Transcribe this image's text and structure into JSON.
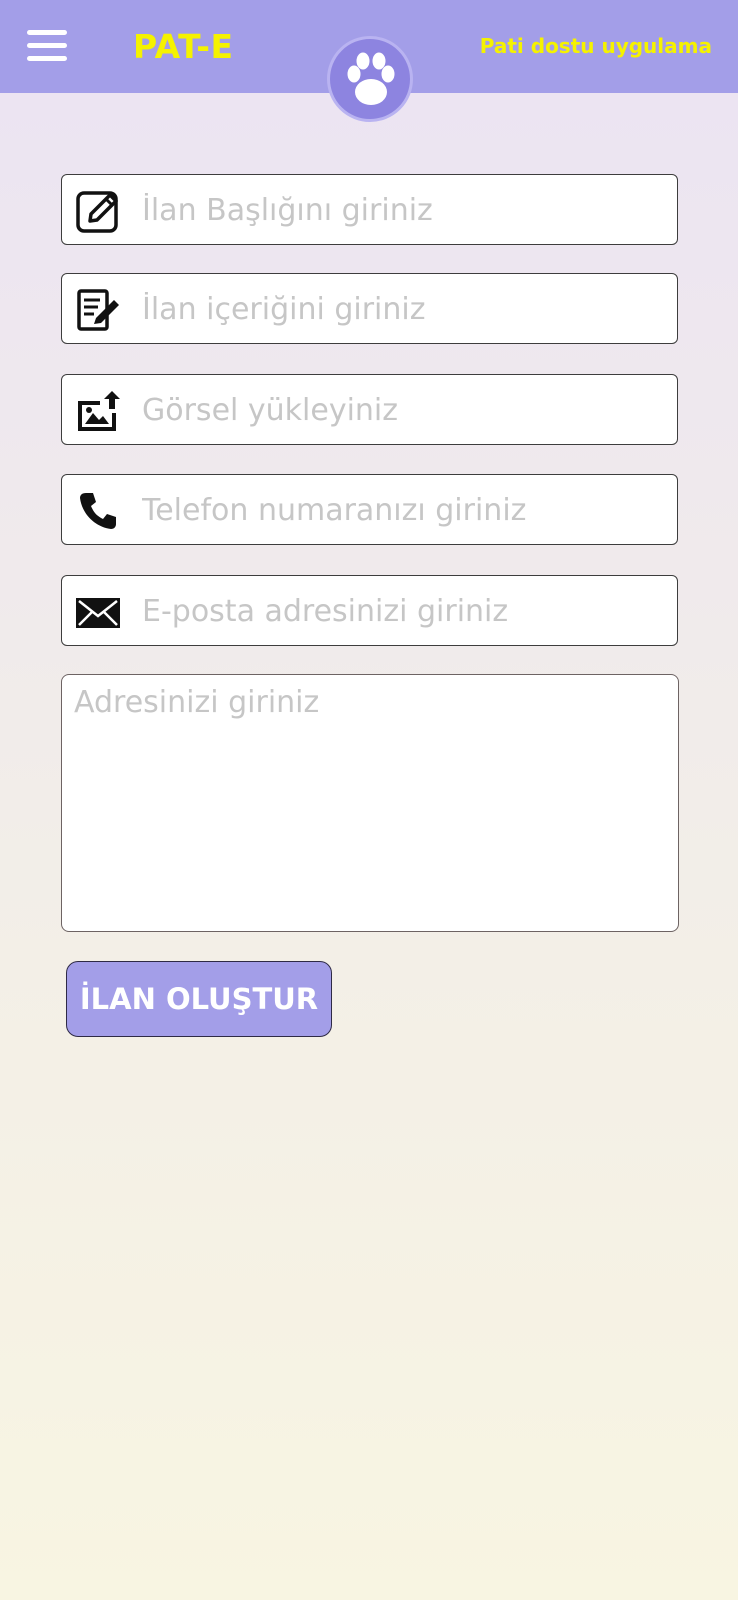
{
  "header": {
    "app_title": "PAT-E",
    "tagline": "Pati dostu uygulama",
    "menu_icon": "hamburger-menu-icon",
    "logo_icon": "paw-icon"
  },
  "form": {
    "title_field": {
      "placeholder": "İlan Başlığını giriniz",
      "value": "",
      "icon": "edit-icon"
    },
    "content_field": {
      "placeholder": "İlan içeriğini giriniz",
      "value": "",
      "icon": "document-edit-icon"
    },
    "image_field": {
      "placeholder": "Görsel yükleyiniz",
      "value": "",
      "icon": "image-upload-icon"
    },
    "phone_field": {
      "placeholder": "Telefon numaranızı giriniz",
      "value": "",
      "icon": "phone-icon"
    },
    "email_field": {
      "placeholder": "E-posta adresinizi giriniz",
      "value": "",
      "icon": "mail-icon"
    },
    "address_field": {
      "placeholder": "Adresinizi giriniz",
      "value": ""
    },
    "submit_label": "İLAN OLUŞTUR"
  },
  "colors": {
    "header_bg": "#a39ee8",
    "title_yellow": "#f5f200",
    "logo_purple": "#8d84e0",
    "button_bg": "#a39ee8",
    "placeholder_gray": "#c6c6c6"
  }
}
